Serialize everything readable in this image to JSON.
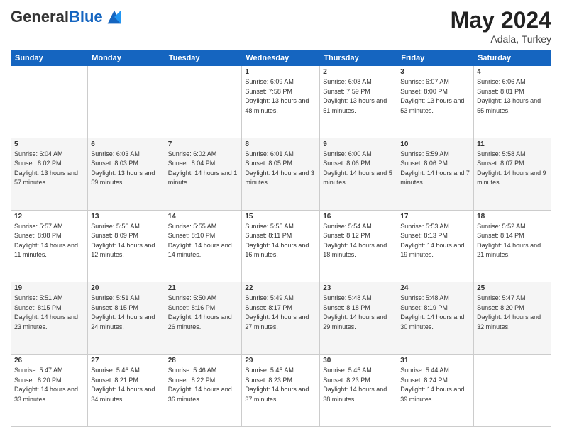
{
  "header": {
    "logo_general": "General",
    "logo_blue": "Blue",
    "month_title": "May 2024",
    "location": "Adala, Turkey"
  },
  "weekdays": [
    "Sunday",
    "Monday",
    "Tuesday",
    "Wednesday",
    "Thursday",
    "Friday",
    "Saturday"
  ],
  "weeks": [
    [
      {
        "day": "",
        "sunrise": "",
        "sunset": "",
        "daylight": ""
      },
      {
        "day": "",
        "sunrise": "",
        "sunset": "",
        "daylight": ""
      },
      {
        "day": "",
        "sunrise": "",
        "sunset": "",
        "daylight": ""
      },
      {
        "day": "1",
        "sunrise": "Sunrise: 6:09 AM",
        "sunset": "Sunset: 7:58 PM",
        "daylight": "Daylight: 13 hours and 48 minutes."
      },
      {
        "day": "2",
        "sunrise": "Sunrise: 6:08 AM",
        "sunset": "Sunset: 7:59 PM",
        "daylight": "Daylight: 13 hours and 51 minutes."
      },
      {
        "day": "3",
        "sunrise": "Sunrise: 6:07 AM",
        "sunset": "Sunset: 8:00 PM",
        "daylight": "Daylight: 13 hours and 53 minutes."
      },
      {
        "day": "4",
        "sunrise": "Sunrise: 6:06 AM",
        "sunset": "Sunset: 8:01 PM",
        "daylight": "Daylight: 13 hours and 55 minutes."
      }
    ],
    [
      {
        "day": "5",
        "sunrise": "Sunrise: 6:04 AM",
        "sunset": "Sunset: 8:02 PM",
        "daylight": "Daylight: 13 hours and 57 minutes."
      },
      {
        "day": "6",
        "sunrise": "Sunrise: 6:03 AM",
        "sunset": "Sunset: 8:03 PM",
        "daylight": "Daylight: 13 hours and 59 minutes."
      },
      {
        "day": "7",
        "sunrise": "Sunrise: 6:02 AM",
        "sunset": "Sunset: 8:04 PM",
        "daylight": "Daylight: 14 hours and 1 minute."
      },
      {
        "day": "8",
        "sunrise": "Sunrise: 6:01 AM",
        "sunset": "Sunset: 8:05 PM",
        "daylight": "Daylight: 14 hours and 3 minutes."
      },
      {
        "day": "9",
        "sunrise": "Sunrise: 6:00 AM",
        "sunset": "Sunset: 8:06 PM",
        "daylight": "Daylight: 14 hours and 5 minutes."
      },
      {
        "day": "10",
        "sunrise": "Sunrise: 5:59 AM",
        "sunset": "Sunset: 8:06 PM",
        "daylight": "Daylight: 14 hours and 7 minutes."
      },
      {
        "day": "11",
        "sunrise": "Sunrise: 5:58 AM",
        "sunset": "Sunset: 8:07 PM",
        "daylight": "Daylight: 14 hours and 9 minutes."
      }
    ],
    [
      {
        "day": "12",
        "sunrise": "Sunrise: 5:57 AM",
        "sunset": "Sunset: 8:08 PM",
        "daylight": "Daylight: 14 hours and 11 minutes."
      },
      {
        "day": "13",
        "sunrise": "Sunrise: 5:56 AM",
        "sunset": "Sunset: 8:09 PM",
        "daylight": "Daylight: 14 hours and 12 minutes."
      },
      {
        "day": "14",
        "sunrise": "Sunrise: 5:55 AM",
        "sunset": "Sunset: 8:10 PM",
        "daylight": "Daylight: 14 hours and 14 minutes."
      },
      {
        "day": "15",
        "sunrise": "Sunrise: 5:55 AM",
        "sunset": "Sunset: 8:11 PM",
        "daylight": "Daylight: 14 hours and 16 minutes."
      },
      {
        "day": "16",
        "sunrise": "Sunrise: 5:54 AM",
        "sunset": "Sunset: 8:12 PM",
        "daylight": "Daylight: 14 hours and 18 minutes."
      },
      {
        "day": "17",
        "sunrise": "Sunrise: 5:53 AM",
        "sunset": "Sunset: 8:13 PM",
        "daylight": "Daylight: 14 hours and 19 minutes."
      },
      {
        "day": "18",
        "sunrise": "Sunrise: 5:52 AM",
        "sunset": "Sunset: 8:14 PM",
        "daylight": "Daylight: 14 hours and 21 minutes."
      }
    ],
    [
      {
        "day": "19",
        "sunrise": "Sunrise: 5:51 AM",
        "sunset": "Sunset: 8:15 PM",
        "daylight": "Daylight: 14 hours and 23 minutes."
      },
      {
        "day": "20",
        "sunrise": "Sunrise: 5:51 AM",
        "sunset": "Sunset: 8:15 PM",
        "daylight": "Daylight: 14 hours and 24 minutes."
      },
      {
        "day": "21",
        "sunrise": "Sunrise: 5:50 AM",
        "sunset": "Sunset: 8:16 PM",
        "daylight": "Daylight: 14 hours and 26 minutes."
      },
      {
        "day": "22",
        "sunrise": "Sunrise: 5:49 AM",
        "sunset": "Sunset: 8:17 PM",
        "daylight": "Daylight: 14 hours and 27 minutes."
      },
      {
        "day": "23",
        "sunrise": "Sunrise: 5:48 AM",
        "sunset": "Sunset: 8:18 PM",
        "daylight": "Daylight: 14 hours and 29 minutes."
      },
      {
        "day": "24",
        "sunrise": "Sunrise: 5:48 AM",
        "sunset": "Sunset: 8:19 PM",
        "daylight": "Daylight: 14 hours and 30 minutes."
      },
      {
        "day": "25",
        "sunrise": "Sunrise: 5:47 AM",
        "sunset": "Sunset: 8:20 PM",
        "daylight": "Daylight: 14 hours and 32 minutes."
      }
    ],
    [
      {
        "day": "26",
        "sunrise": "Sunrise: 5:47 AM",
        "sunset": "Sunset: 8:20 PM",
        "daylight": "Daylight: 14 hours and 33 minutes."
      },
      {
        "day": "27",
        "sunrise": "Sunrise: 5:46 AM",
        "sunset": "Sunset: 8:21 PM",
        "daylight": "Daylight: 14 hours and 34 minutes."
      },
      {
        "day": "28",
        "sunrise": "Sunrise: 5:46 AM",
        "sunset": "Sunset: 8:22 PM",
        "daylight": "Daylight: 14 hours and 36 minutes."
      },
      {
        "day": "29",
        "sunrise": "Sunrise: 5:45 AM",
        "sunset": "Sunset: 8:23 PM",
        "daylight": "Daylight: 14 hours and 37 minutes."
      },
      {
        "day": "30",
        "sunrise": "Sunrise: 5:45 AM",
        "sunset": "Sunset: 8:23 PM",
        "daylight": "Daylight: 14 hours and 38 minutes."
      },
      {
        "day": "31",
        "sunrise": "Sunrise: 5:44 AM",
        "sunset": "Sunset: 8:24 PM",
        "daylight": "Daylight: 14 hours and 39 minutes."
      },
      {
        "day": "",
        "sunrise": "",
        "sunset": "",
        "daylight": ""
      }
    ]
  ]
}
